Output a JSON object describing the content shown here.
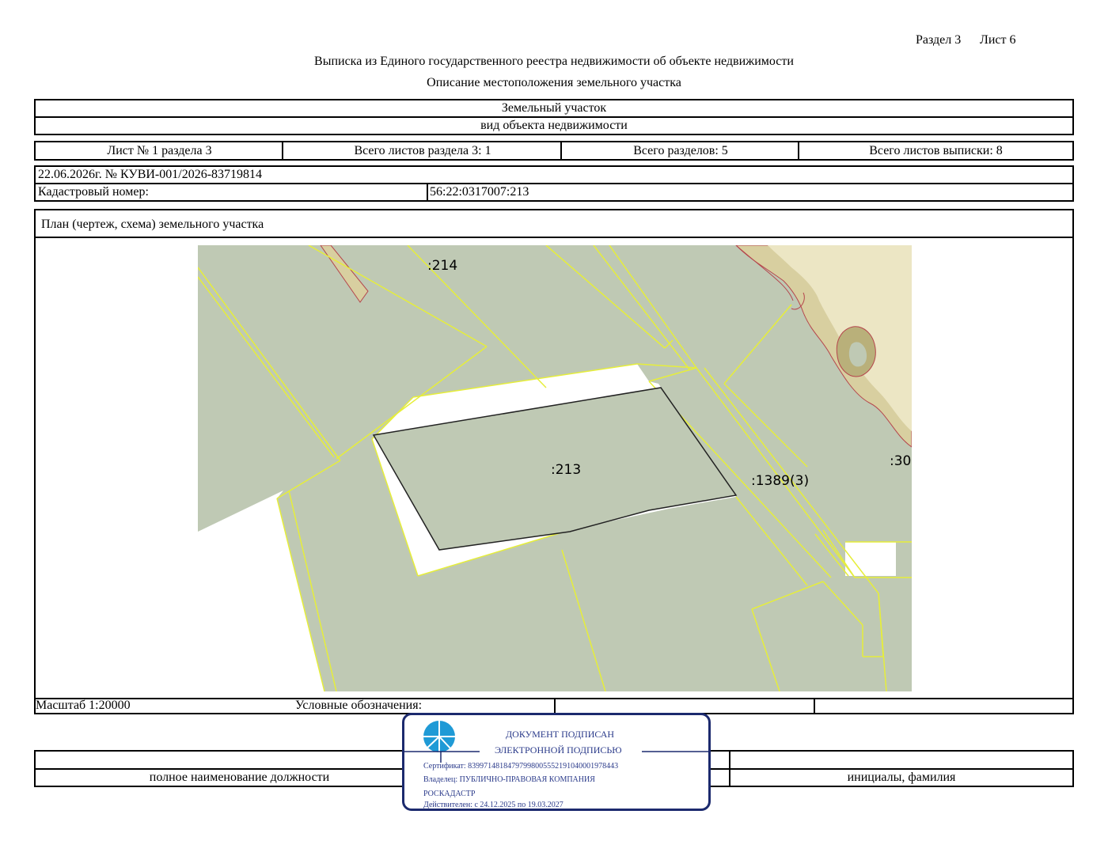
{
  "header": {
    "section": "Раздел 3",
    "sheet": "Лист 6",
    "title": "Выписка из Единого государственного реестра недвижимости об объекте недвижимости",
    "subtitle": "Описание местоположения земельного участка"
  },
  "object": {
    "type": "Земельный участок",
    "type_caption": "вид объекта недвижимости"
  },
  "sheet_info": {
    "sheet_no": "Лист № 1 раздела 3",
    "total_section_sheets": "Всего листов раздела 3: 1",
    "total_sections": "Всего разделов: 5",
    "total_extract_sheets": "Всего листов выписки: 8"
  },
  "record": {
    "date_number": "22.06.2026г. № КУВИ-001/2026-83719814",
    "cadastral_label": "Кадастровый номер:",
    "cadastral_value": "56:22:0317007:213"
  },
  "plan": {
    "title": "План (чертеж, схема) земельного участка",
    "labels": {
      "parcel_214": ":214",
      "parcel_213": ":213",
      "parcel_1389": ":1389(3)",
      "parcel_30": ":30"
    },
    "colors": {
      "parcel_fill": "#bfc9b4",
      "boundary": "#e6ee3a",
      "terrain_light": "#ece6c4",
      "terrain_mid": "#d8cfa0",
      "terrain_dark": "#b9b07a",
      "contour_red": "#b5454c"
    }
  },
  "legend": {
    "scale": "Масштаб 1:20000",
    "legend_label": "Условные обозначения:"
  },
  "signature": {
    "position_caption": "полное наименование должности",
    "name_caption": "инициалы, фамилия"
  },
  "stamp": {
    "line1": "ДОКУМЕНТ ПОДПИСАН",
    "line2": "ЭЛЕКТРОННОЙ ПОДПИСЬЮ",
    "certificate": "Сертификат: 83997148184797998005552191040001978443",
    "owner": "Владелец: ПУБЛИЧНО-ПРАВОВАЯ КОМПАНИЯ",
    "owner2": "РОСКАДАСТР",
    "valid": "Действителен: с 24.12.2025 по 19.03.2027",
    "colors": {
      "border": "#1c2a6e",
      "text": "#2a3a8a",
      "logo": "#1f9ad6"
    }
  }
}
